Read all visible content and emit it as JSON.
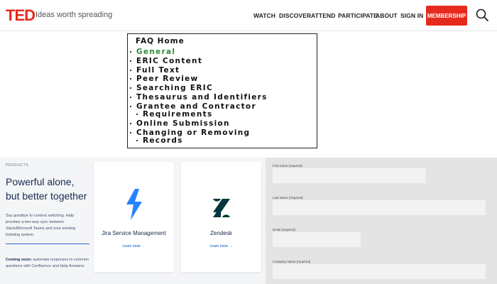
{
  "header": {
    "logo": "TED",
    "tagline": "Ideas worth spreading",
    "nav": [
      "WATCH",
      "DISCOVER",
      "ATTEND",
      "PARTICIPATE",
      "ABOUT",
      "SIGN IN"
    ],
    "membership_label": "MEMBERSHIP",
    "brand_color": "#e62b1e"
  },
  "faq": {
    "home": "FAQ Home",
    "items": [
      "General",
      "ERIC Content",
      "Full Text",
      "Peer Review",
      "Searching ERIC",
      "Thesaurus and Identifiers",
      "Grantee and Contractor",
      "Requirements",
      "Online Submission",
      "Changing or Removing",
      "Records"
    ],
    "active_color": "#2e8b3a"
  },
  "promo": {
    "eyebrow": "PRODUCTS",
    "title": "Powerful alone, but better together",
    "description": "Say goodbye to context switching. Halp provides a two-way sync between Slack/Microsoft Teams and your existing ticketing system.",
    "note_bold": "Coming soon:",
    "note_rest": " automate responses to common questions with Confluence and Halp Answers.",
    "cards": [
      {
        "name": "Jira Service Management",
        "link": "Learn more →",
        "icon": "jira-bolt-icon",
        "icon_color": "#2684ff"
      },
      {
        "name": "Zendesk",
        "link": "Learn more →",
        "icon": "zendesk-icon",
        "icon_color": "#03363d"
      }
    ]
  },
  "form": {
    "fields": [
      {
        "label": "First name (required)"
      },
      {
        "label": "Last Name (required)"
      },
      {
        "label": "Email (required)"
      },
      {
        "label": "Company Name (required)"
      }
    ]
  }
}
